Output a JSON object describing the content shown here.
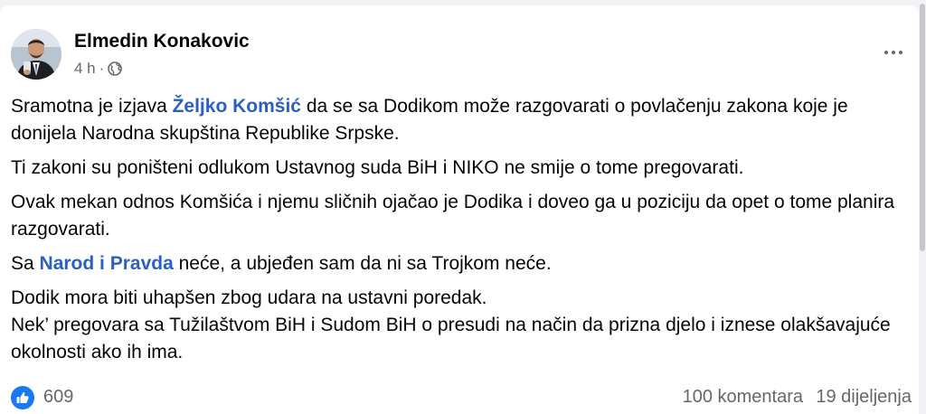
{
  "post": {
    "author": "Elmedin Konakovic",
    "time": "4 h",
    "separator": "·",
    "audience_icon": "globe-icon",
    "more_icon": "more-options-icon",
    "paragraphs": [
      {
        "text_before": "Sramotna je izjava ",
        "mention": "Željko Komšić",
        "text_after": " da se sa Dodikom može razgovarati o povlačenju zakona koje je donijela Narodna skupština Republike Srpske."
      },
      {
        "text": "Ti zakoni su poništeni odlukom Ustavnog suda BiH i NIKO ne smije o tome pregovarati."
      },
      {
        "text": "Ovak mekan odnos Komšića i njemu sličnih ojačao je Dodika i doveo ga u poziciju da opet o tome planira razgovarati."
      },
      {
        "text_before": "Sa ",
        "mention": "Narod i Pravda",
        "text_after": " neće, a ubjeđen sam da ni sa Trojkom neće."
      },
      {
        "line1": "Dodik mora biti uhapšen zbog udara na ustavni poredak.",
        "line2": "Nek’ pregovara sa Tužilaštvom BiH i Sudom BiH o presudi na način da prizna djelo i iznese olakšavajuće okolnosti ako ih ima."
      }
    ]
  },
  "footer": {
    "like_icon": "like-thumb-icon",
    "reactions": "609",
    "comments": "100 komentara",
    "shares": "19 dijeljenja"
  },
  "colors": {
    "link": "#2a5fc4",
    "like_blue": "#1877f2",
    "secondary_text": "#65676b"
  }
}
